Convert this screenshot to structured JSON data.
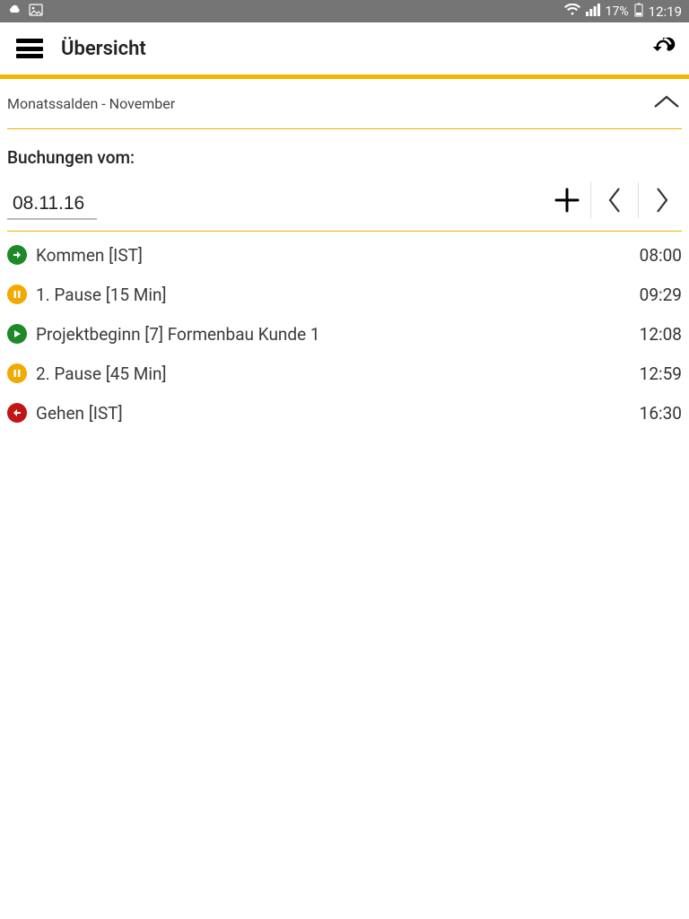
{
  "status": {
    "battery_pct": "17%",
    "clock": "12:19"
  },
  "header": {
    "title": "Übersicht"
  },
  "month": {
    "label": "Monatssalden - November"
  },
  "bookings": {
    "label": "Buchungen vom:",
    "date": "08.11.16"
  },
  "entries": [
    {
      "icon": "arrive",
      "label": "Kommen [IST]",
      "time": "08:00"
    },
    {
      "icon": "pause",
      "label": "1. Pause [15 Min]",
      "time": "09:29"
    },
    {
      "icon": "play",
      "label": "Projektbeginn [7] Formenbau Kunde 1",
      "time": "12:08"
    },
    {
      "icon": "pause",
      "label": "2. Pause [45 Min]",
      "time": "12:59"
    },
    {
      "icon": "leave",
      "label": "Gehen [IST]",
      "time": "16:30"
    }
  ]
}
